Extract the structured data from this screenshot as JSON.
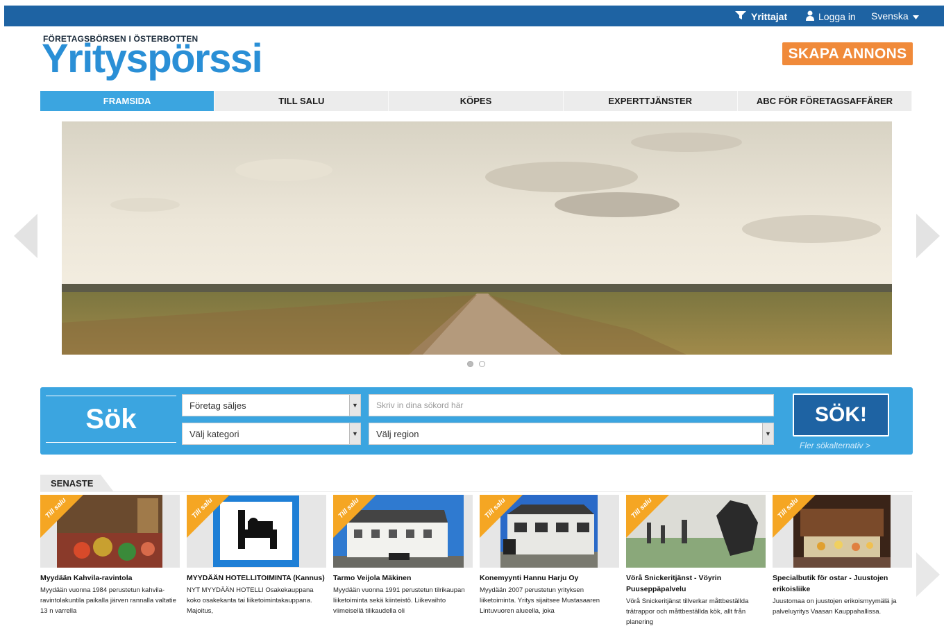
{
  "topbar": {
    "yrittajat": "Yrittajat",
    "login": "Logga in",
    "language": "Svenska"
  },
  "logo": {
    "subtitle": "FÖRETAGSBÖRSEN I ÖSTERBOTTEN",
    "name": "Yrityspörssi"
  },
  "cta": "SKAPA ANNONS",
  "nav": {
    "tabs": [
      {
        "label": "FRAMSIDA",
        "active": true
      },
      {
        "label": "TILL SALU"
      },
      {
        "label": "KÖPES"
      },
      {
        "label": "EXPERTTJÄNSTER"
      },
      {
        "label": "ABC FÖR FÖRETAGSAFFÄRER"
      }
    ]
  },
  "search": {
    "label": "Sök",
    "company_select": "Företag säljes",
    "keywords_placeholder": "Skriv in dina sökord här",
    "category_select": "Välj kategori",
    "region_select": "Välj region",
    "button": "SÖK!",
    "more_link": "Fler sökalternativ >"
  },
  "latest": {
    "tab_label": "SENASTE",
    "ribbon": "Till salu",
    "items": [
      {
        "title": "Myydään Kahvila-ravintola",
        "desc": "Myydään vuonna 1984 perustetun kahvila- ravintolakuntila paikalla järven rannalla valtatie 13 n varrella"
      },
      {
        "title": "MYYDÄÄN HOTELLITOIMINTA (Kannus)",
        "desc": "NYT MYYDÄÄN HOTELLI Osakekauppana koko osakekanta tai liiketoimintakauppana. Majoitus,"
      },
      {
        "title": "Tarmo Veijola Mäkinen",
        "desc": "Myydään vuonna 1991 perustetun tilrikaupan liiketoiminta sekä kiinteistö. Liikevaihto viimeisellä tilikaudella oli"
      },
      {
        "title": "Konemyynti Hannu Harju Oy",
        "desc": "Myydään 2007 perustetun yrityksen liiketoiminta. Yritys sijaitsee Mustasaaren Lintuvuoren alueella, joka"
      },
      {
        "title": "Vörå Snickeritjänst - Vöyrin Puuseppäpalvelu",
        "desc": "Vörå Snickeritjänst tillverkar måttbeställda trätrappor och måttbeställda kök, allt från planering"
      },
      {
        "title": "Specialbutik för ostar - Juustojen erikoisliike",
        "desc": "Juustomaa on juustojen erikoismyymälä ja palveluyritys Vaasan Kauppahallissa."
      }
    ]
  },
  "colors": {
    "topbar": "#1e63a3",
    "accent": "#3ba5e0",
    "cta": "#f08a3a",
    "ribbon": "#f5a623"
  }
}
